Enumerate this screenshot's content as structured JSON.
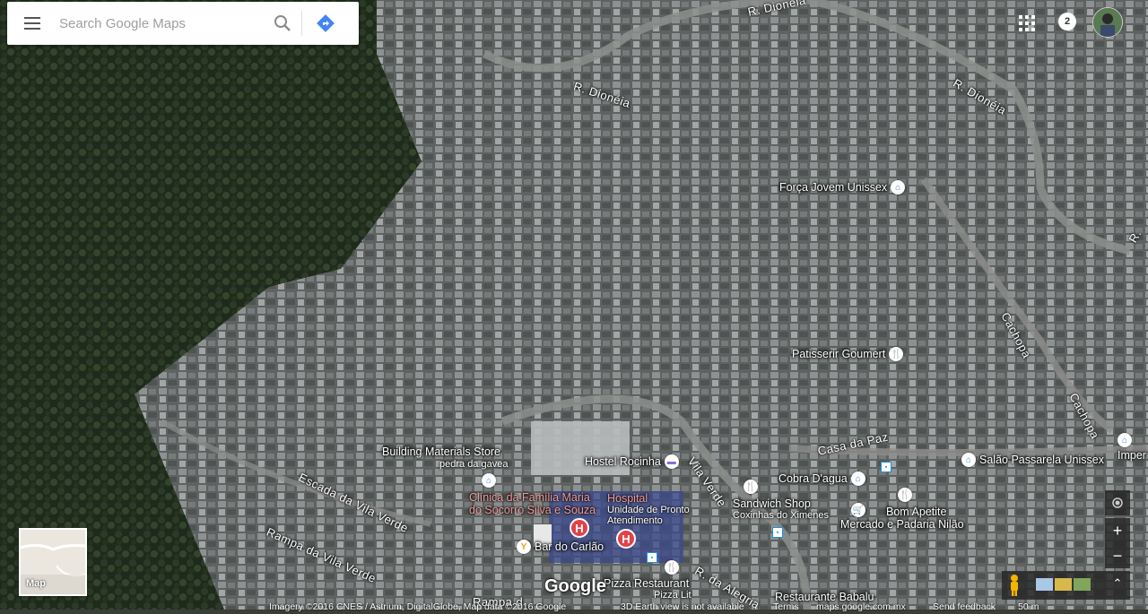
{
  "search": {
    "placeholder": "Search Google Maps"
  },
  "header": {
    "notification_count": "2"
  },
  "map_type_card": {
    "label": "Map"
  },
  "logo": "Google",
  "streets": {
    "dioneia_1": "R. Dionéia",
    "dioneia_2": "R. Dionéia",
    "dioneia_3": "R. Dionéia",
    "cachopa_1": "Cachopa",
    "cachopa_2": "Cachopa",
    "casa_da_paz": "Casa da Paz",
    "vila_verde": "Vila Verde",
    "escada_vila_verde": "Escada da Vila Verde",
    "rampa_vila_verde": "Rampa da Vila Verde",
    "rampa_2": "Rampa d",
    "alegria": "R. da Alegria",
    "r_edge": "R."
  },
  "places": {
    "forca_jovem": "Força Jovem Unissex",
    "patisserie": "Patisserir Goumert",
    "building_materials": "Building Materials Store",
    "pedra_da_gavea": "pedra da gavea",
    "clinica_line1": "Clínica da Família Maria",
    "clinica_line2": "do Socorro Silva e Souza",
    "hostel": "Hostel Rocinha",
    "hospital": "Hospital",
    "upa_line1": "Unidade de Pronto",
    "upa_line2": "Atendimento",
    "cobra": "Cobra D'agua",
    "sandwich": "Sandwich Shop",
    "coxinhas": "Coxinhas do Ximenes",
    "bom_apetite": "Bom Apetite",
    "mercado": "Mercado e Padaria Nilão",
    "salao": "Salão Passarela Unissex",
    "imper": "Imper",
    "bar_carlao": "Bar do Carlão",
    "pizza": "Pizza Restaurant",
    "pizza_lit": "Pizza Lit",
    "babalu": "Restaurante Babalu"
  },
  "footer": {
    "imagery": "Imagery ©2016 CNES / Astrium, DigitalGlobe, Map data ©2016 Google",
    "earth_view": "3D Earth view is not available",
    "terms": "Terms",
    "domain": "maps.google.com.mx",
    "feedback": "Send feedback",
    "scale": "50 m"
  },
  "colors": {
    "forest": "#23301f",
    "urban": "#6d7070",
    "road": "#8a8c88"
  }
}
